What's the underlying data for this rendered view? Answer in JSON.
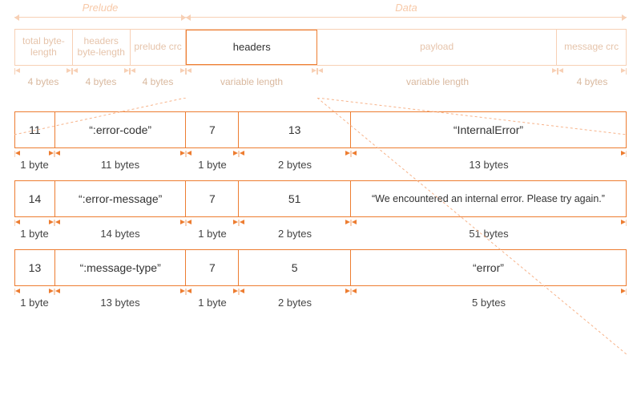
{
  "top_brackets": {
    "prelude": "Prelude",
    "data": "Data"
  },
  "top_fields": {
    "total_byte_length": "total byte-length",
    "headers_byte_length": "headers byte-length",
    "prelude_crc": "prelude crc",
    "headers": "headers",
    "payload": "payload",
    "message_crc": "message crc"
  },
  "top_sizes": {
    "s1": "4 bytes",
    "s2": "4 bytes",
    "s3": "4 bytes",
    "s4": "variable length",
    "s5": "variable length",
    "s6": "4 bytes"
  },
  "rows": [
    {
      "c1": "11",
      "c2": "“:error-code”",
      "c3": "7",
      "c4": "13",
      "c5": "“InternalError”",
      "s1": "1 byte",
      "s2": "11 bytes",
      "s3": "1 byte",
      "s4": "2 bytes",
      "s5": "13 bytes"
    },
    {
      "c1": "14",
      "c2": "“:error-message”",
      "c3": "7",
      "c4": "51",
      "c5": "“We encountered an internal error. Please try again.”",
      "s1": "1 byte",
      "s2": "14 bytes",
      "s3": "1 byte",
      "s4": "2 bytes",
      "s5": "51 bytes"
    },
    {
      "c1": "13",
      "c2": "“:message-type”",
      "c3": "7",
      "c4": "5",
      "c5": "“error”",
      "s1": "1 byte",
      "s2": "13 bytes",
      "s3": "1 byte",
      "s4": "2 bytes",
      "s5": "5 bytes"
    }
  ]
}
